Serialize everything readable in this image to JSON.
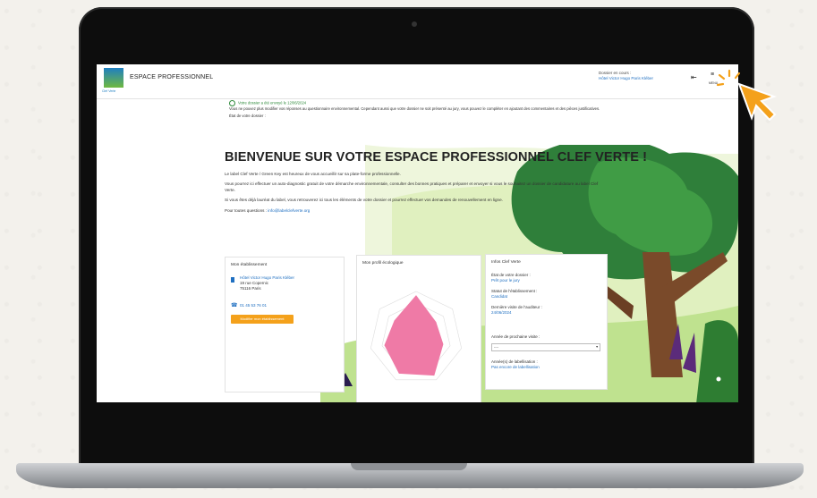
{
  "header": {
    "logo_caption": "Clef Verte",
    "title": "ESPACE PROFESSIONNEL",
    "dossier_label": "Dossier en cours :",
    "dossier_name": "Hôtel Victor Hugo Paris Kléber",
    "logout_icon": "logout-icon",
    "menu_icon": "hamburger-icon",
    "menu_label": "MENU"
  },
  "notice": {
    "status": "Votre dossier a été envoyé le 12/06/2024",
    "body": "Vous ne pouvez plus modifier vos réponses au questionnaire environnemental. Cependant aussi que votre dossier ne soit présenté au jury, vous pouvez le compléter en ajoutant des commentaires et des pièces justificatives.",
    "state": "État de votre dossier :"
  },
  "welcome": {
    "title": "BIENVENUE SUR VOTRE ESPACE PROFESSIONNEL CLEF VERTE !",
    "p1": "Le label Clef Verte / Green Key est heureux de vous accueillir sur sa plate-forme professionnelle.",
    "p2": "Vous pourrez ici effectuer un auto-diagnostic gratuit de votre démarche environnementale, consulter des bonnes pratiques et préparer et envoyer si vous le souhaitez un dossier de candidature au label Clef Verte.",
    "p3": "Si vous êtes déjà lauréat du label, vous retrouverez ici tous les éléments de votre dossier et pourrez effectuer vos demandes de renouvellement en ligne.",
    "contact_prefix": "Pour toutes questions :",
    "contact_email": "info@labelclefverte.org"
  },
  "establishment": {
    "title": "Mon établissement",
    "name": "Hôtel Victor Hugo Paris Kléber",
    "street": "19 rue Copernic",
    "city": "75116 Paris",
    "phone": "01 45 53 76 01",
    "button": "Modifier mon établissement"
  },
  "profile": {
    "title": "Mon profil écologique"
  },
  "info": {
    "title": "Infos Clef Verte",
    "state_label": "État de votre dossier :",
    "state_value": "Prêt pour le jury",
    "status_label": "Statut de l'établissement :",
    "status_value": "Candidat",
    "visit_label": "Dernière visite de l'auditeur :",
    "visit_value": "24/06/2024",
    "next_visit_label": "Année de prochaine visite :",
    "next_visit_value": "----",
    "years_label": "Année(s) de labellisation :",
    "years_value": "Pas encore de labellisation"
  },
  "chart_data": {
    "type": "radar",
    "title": "Mon profil écologique",
    "color": "#ef7aa6"
  },
  "colors": {
    "accent_blue": "#1f6fc1",
    "accent_orange": "#f4a11b",
    "success_green": "#2d8a3a"
  }
}
